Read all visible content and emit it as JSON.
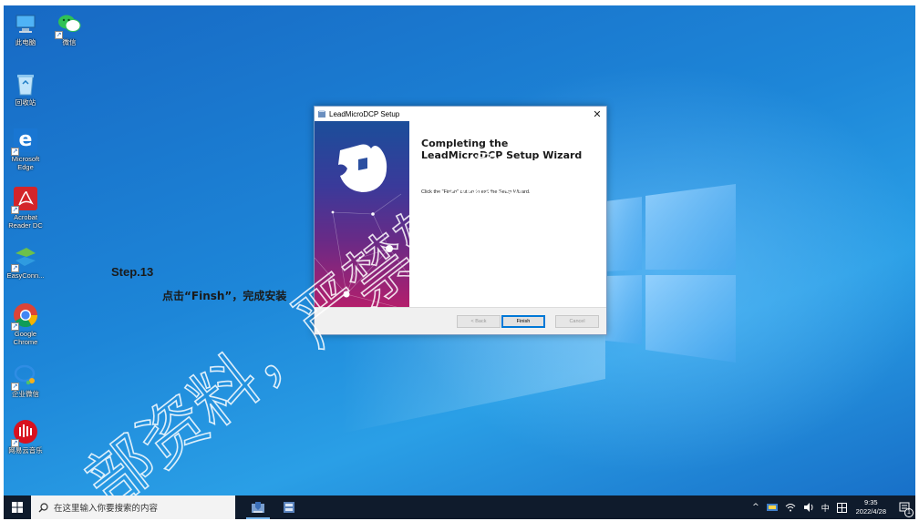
{
  "desktop": {
    "icons": [
      {
        "label": "此电脑"
      },
      {
        "label": "微信"
      },
      {
        "label": "回收站"
      },
      {
        "label": "Microsoft Edge"
      },
      {
        "label": "Acrobat Reader DC"
      },
      {
        "label": "EasyConn..."
      },
      {
        "label": "Google Chrome"
      },
      {
        "label": "企业微信"
      },
      {
        "label": "网易云音乐"
      }
    ]
  },
  "overlay": {
    "step": "Step.13",
    "instruction": "点击“Finsh”，完成安装"
  },
  "dialog": {
    "title": "LeadMicroDCP Setup",
    "heading_line1": "Completing the",
    "heading_line2": "LeadMicroDCP Setup Wizard",
    "message": "Click the \"Finish\" button to exit the Setup Wizard.",
    "buttons": {
      "back": "< Back",
      "finish": "Finish",
      "cancel": "Cancel"
    },
    "close_glyph": "✕"
  },
  "watermark": {
    "text": "部资料，严禁转载、"
  },
  "taskbar": {
    "search_placeholder": "在这里输入你要搜索的内容",
    "tray": {
      "chevron": "^",
      "ime": "中",
      "time": "9:35",
      "date": "2022/4/28",
      "notification_count": "1"
    }
  },
  "colors": {
    "taskbar": "#0f1b2c",
    "desktop": "#1d86d8",
    "accent": "#0078d7"
  }
}
